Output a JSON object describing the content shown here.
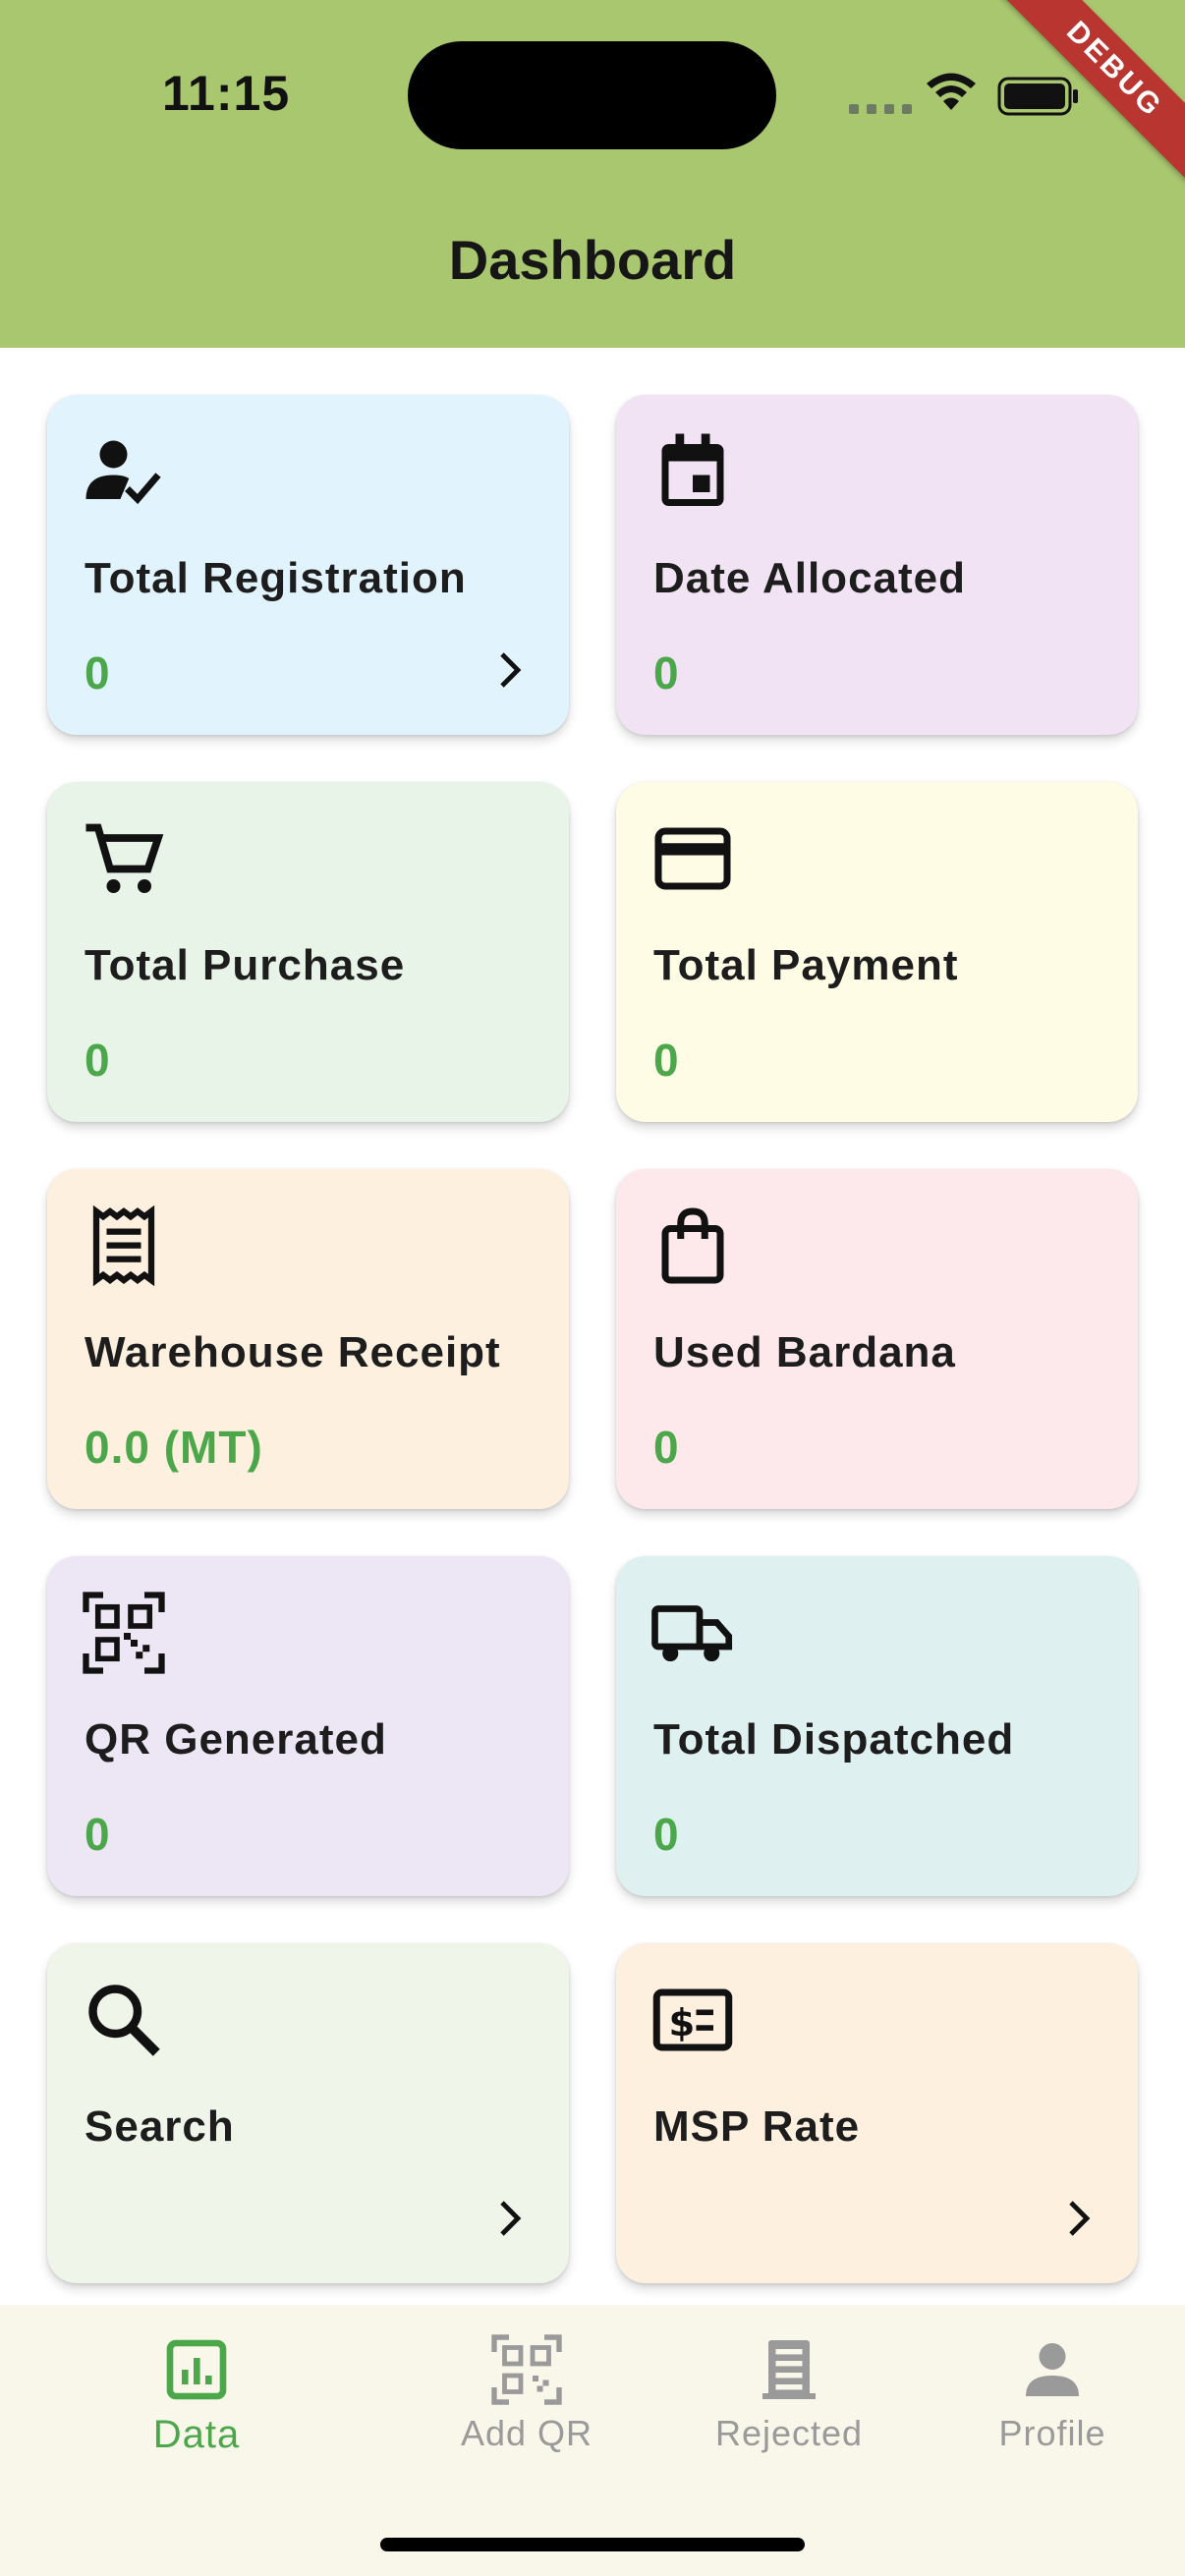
{
  "status_bar": {
    "time": "11:15",
    "debug_label": "DEBUG"
  },
  "header": {
    "title": "Dashboard",
    "background": "#a9c76f"
  },
  "cards": [
    {
      "label": "Total Registration",
      "value": "0",
      "icon": "person-check-icon",
      "bg": "#e1f3fc",
      "chevron": true
    },
    {
      "label": "Date Allocated",
      "value": "0",
      "icon": "calendar-icon",
      "bg": "#f1e3f4",
      "chevron": false
    },
    {
      "label": "Total Purchase",
      "value": "0",
      "icon": "cart-icon",
      "bg": "#e7f4e7",
      "chevron": false
    },
    {
      "label": "Total Payment",
      "value": "0",
      "icon": "credit-card-icon",
      "bg": "#fffce6",
      "chevron": false
    },
    {
      "label": "Warehouse Receipt",
      "value": "0.0 (MT)",
      "icon": "receipt-icon",
      "bg": "#fdf0de",
      "chevron": false
    },
    {
      "label": "Used Bardana",
      "value": "0",
      "icon": "shopping-bag-icon",
      "bg": "#fde8ec",
      "chevron": false
    },
    {
      "label": "QR Generated",
      "value": "0",
      "icon": "qr-code-icon",
      "bg": "#ece6f5",
      "chevron": false
    },
    {
      "label": "Total Dispatched",
      "value": "0",
      "icon": "truck-icon",
      "bg": "#def0f0",
      "chevron": false
    },
    {
      "label": "Search",
      "value": "",
      "icon": "search-icon",
      "bg": "#eff5e9",
      "chevron": true
    },
    {
      "label": "MSP Rate",
      "value": "",
      "icon": "money-icon",
      "bg": "#fdf0de",
      "chevron": true
    }
  ],
  "bottom_nav": [
    {
      "label": "Data",
      "icon": "chart-icon",
      "active": true
    },
    {
      "label": "Add QR",
      "icon": "qr-code-icon",
      "active": false
    },
    {
      "label": "Rejected",
      "icon": "building-icon",
      "active": false
    },
    {
      "label": "Profile",
      "icon": "person-icon",
      "active": false
    }
  ],
  "colors": {
    "value_green": "#4ba74a",
    "nav_active": "#4ba74a",
    "nav_inactive": "#9a9a9a"
  }
}
